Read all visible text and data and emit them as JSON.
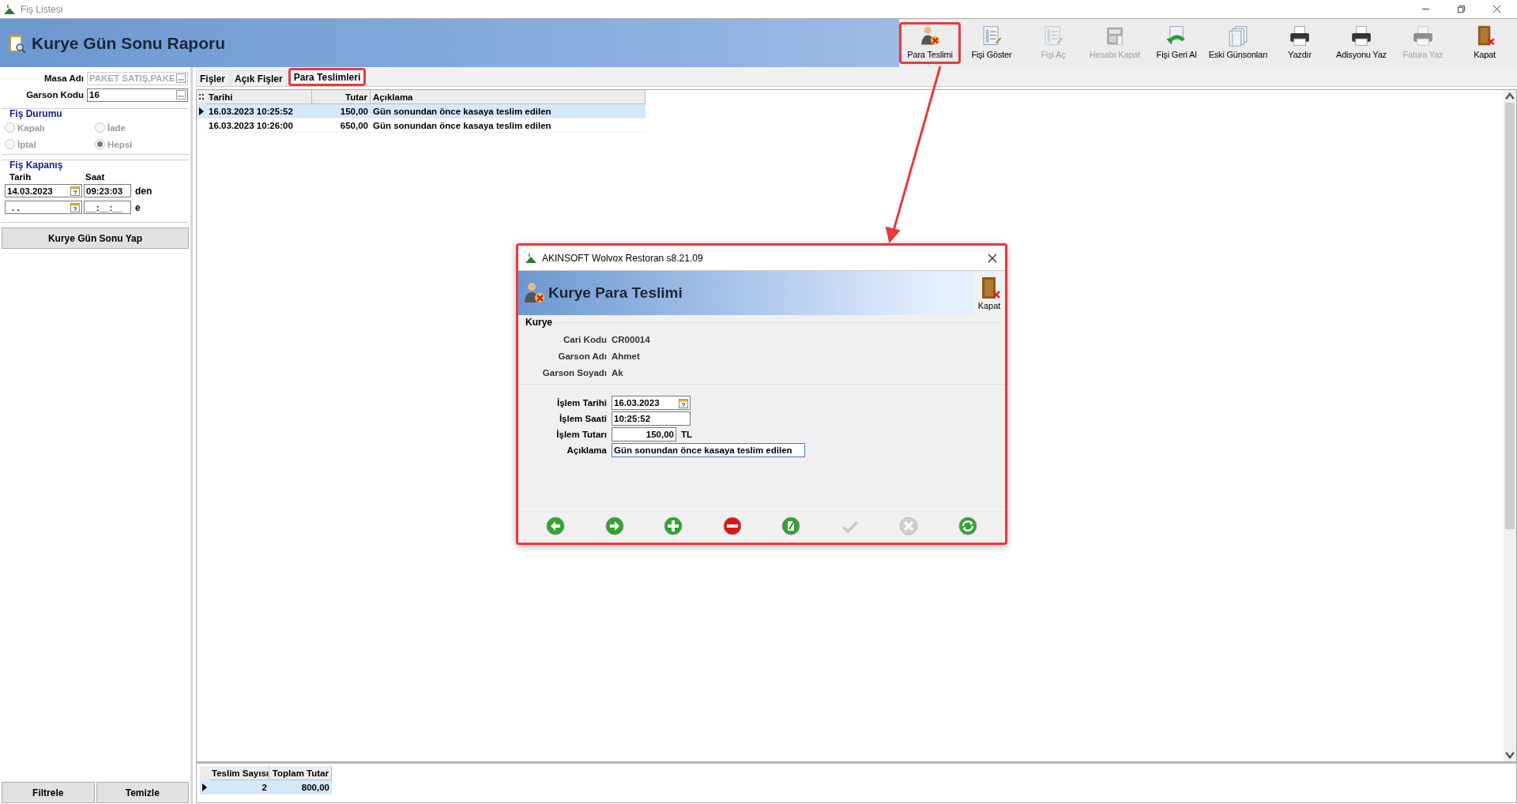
{
  "window": {
    "title": "Fiş Listesi"
  },
  "header": {
    "title": "Kurye Gün Sonu Raporu"
  },
  "toolbar": [
    {
      "kind": "courier",
      "label": "Para Teslimi",
      "disabled": false,
      "highlighted": true
    },
    {
      "kind": "receipt",
      "label": "Fişi Göster",
      "disabled": false,
      "highlighted": false
    },
    {
      "kind": "receipt",
      "label": "Fişi Aç",
      "disabled": true,
      "highlighted": false
    },
    {
      "kind": "register",
      "label": "Hesabı Kapat",
      "disabled": true,
      "highlighted": false
    },
    {
      "kind": "undo",
      "label": "Fişi Geri Al",
      "disabled": false,
      "highlighted": false
    },
    {
      "kind": "stack",
      "label": "Eski Günsonları",
      "disabled": false,
      "highlighted": false
    },
    {
      "kind": "printer",
      "label": "Yazdır",
      "disabled": false,
      "highlighted": false
    },
    {
      "kind": "printer",
      "label": "Adisyonu Yaz",
      "disabled": false,
      "highlighted": false
    },
    {
      "kind": "printer",
      "label": "Fatura Yaz",
      "disabled": true,
      "highlighted": false
    },
    {
      "kind": "door",
      "label": "Kapat",
      "disabled": false,
      "highlighted": false
    }
  ],
  "filters": {
    "masa_adi": {
      "label": "Masa Adı",
      "value": "PAKET SATIŞ,PAKE",
      "disabled": true
    },
    "garson_kodu": {
      "label": "Garson Kodu",
      "value": "16",
      "disabled": false
    },
    "fis_durumu": {
      "title": "Fiş Durumu",
      "disabled": true,
      "options": [
        {
          "label": "Kapalı",
          "selected": false
        },
        {
          "label": "İade",
          "selected": false
        },
        {
          "label": "İptal",
          "selected": false
        },
        {
          "label": "Hepsi",
          "selected": true
        }
      ]
    },
    "fis_kapanis": {
      "title": "Fiş Kapanış",
      "date_label": "Tarih",
      "time_label": "Saat",
      "from_date": "14.03.2023",
      "from_time": "09:23:03",
      "from_suffix": "den",
      "to_date": ". .",
      "to_time": "__:__:__",
      "to_suffix": "e"
    },
    "run_button": "Kurye Gün Sonu Yap",
    "filter_button": "Filtrele",
    "clear_button": "Temizle"
  },
  "tabs": [
    {
      "label": "Fişler",
      "selected": false,
      "highlighted": false
    },
    {
      "label": "Açık Fişler",
      "selected": false,
      "highlighted": false
    },
    {
      "label": "Para Teslimleri",
      "selected": true,
      "highlighted": true
    }
  ],
  "grid": {
    "columns": [
      "Tarihi",
      "Tutar",
      "Açıklama"
    ],
    "rows": [
      {
        "cells": [
          "16.03.2023 10:25:52",
          "150,00",
          "Gün sonundan önce kasaya teslim edilen"
        ],
        "selected": true
      },
      {
        "cells": [
          "16.03.2023 10:26:00",
          "650,00",
          "Gün sonundan önce kasaya teslim edilen"
        ],
        "selected": false
      }
    ]
  },
  "summary": {
    "columns": [
      "Teslim Sayısı",
      "Toplam Tutar"
    ],
    "rows": [
      {
        "cells": [
          "2",
          "800,00"
        ],
        "selected": true
      }
    ]
  },
  "dialog": {
    "title": "AKINSOFT Wolvox Restoran s8.21.09",
    "header": "Kurye Para Teslimi",
    "close_label": "Kapat",
    "group": "Kurye",
    "info": [
      {
        "label": "Cari Kodu",
        "value": "CR00014"
      },
      {
        "label": "Garson Adı",
        "value": "Ahmet"
      },
      {
        "label": "Garson Soyadı",
        "value": "Ak"
      }
    ],
    "fields": [
      {
        "kind": "date",
        "label": "İşlem Tarihi",
        "value": "16.03.2023"
      },
      {
        "kind": "time",
        "label": "İşlem Saati",
        "value": "10:25:52"
      },
      {
        "kind": "amount",
        "label": "İşlem Tutarı",
        "value": "150,00",
        "unit": "TL"
      },
      {
        "kind": "memo",
        "label": "Açıklama",
        "value": "Gün sonundan önce kasaya teslim edilen"
      }
    ],
    "nav_buttons": [
      {
        "kind": "prev",
        "disabled": false
      },
      {
        "kind": "next",
        "disabled": false
      },
      {
        "kind": "add",
        "disabled": false
      },
      {
        "kind": "delete",
        "disabled": false
      },
      {
        "kind": "edit",
        "disabled": false
      },
      {
        "kind": "post",
        "disabled": true
      },
      {
        "kind": "cancel",
        "disabled": true
      },
      {
        "kind": "refresh",
        "disabled": false
      }
    ]
  }
}
